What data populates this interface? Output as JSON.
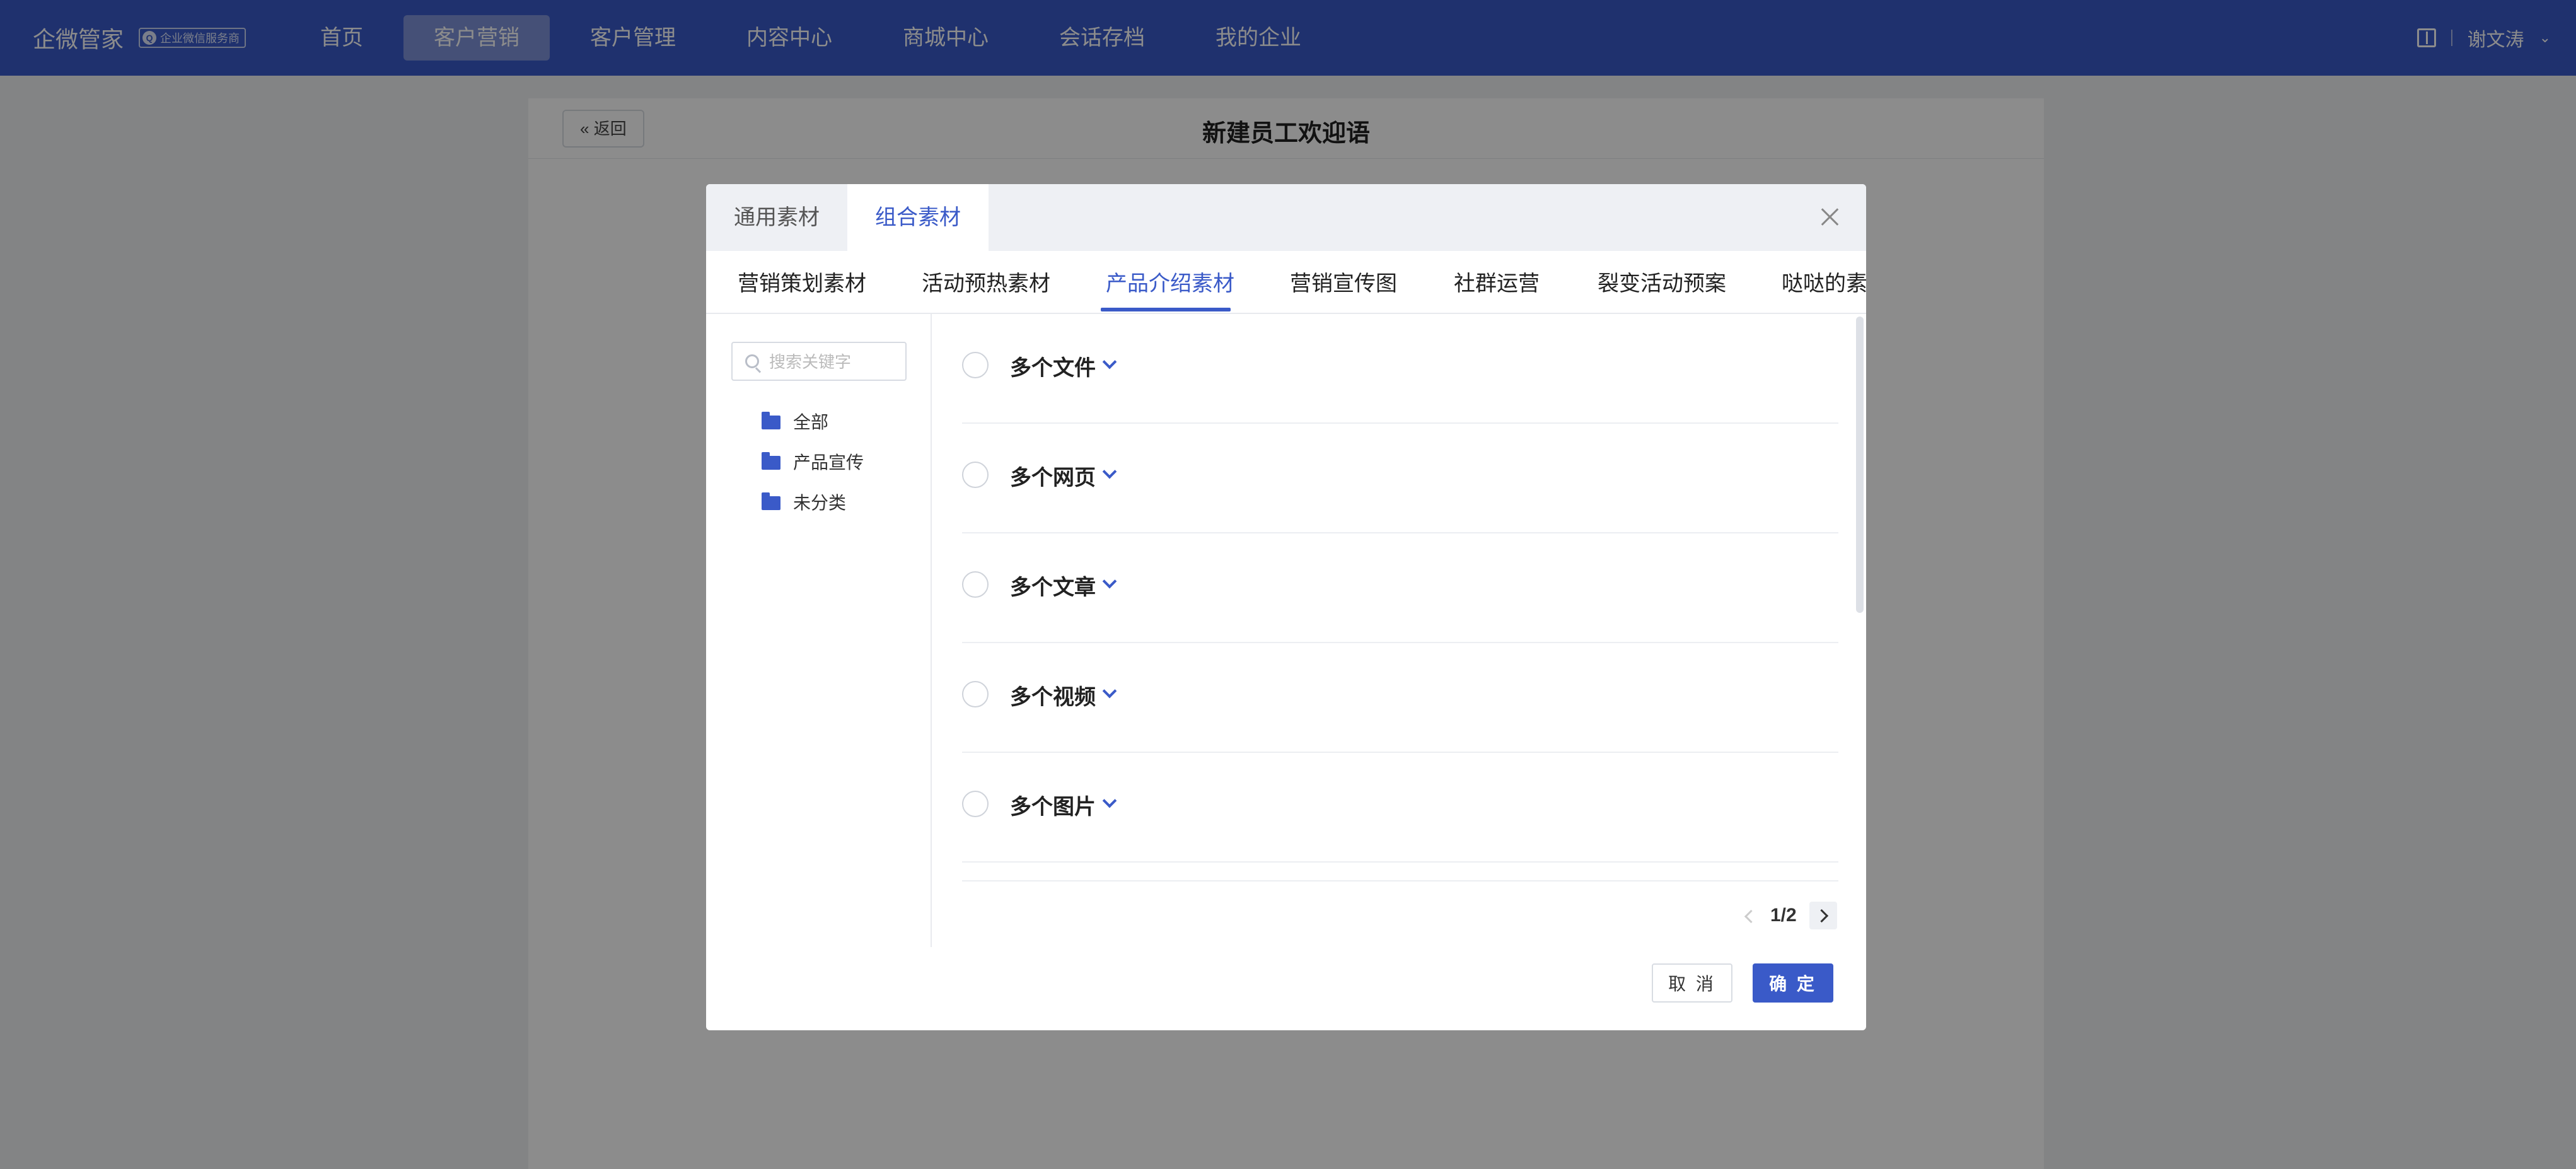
{
  "topbar": {
    "brand": "企微管家",
    "badge": "企业微信服务商",
    "nav": [
      "首页",
      "客户营销",
      "客户管理",
      "内容中心",
      "商城中心",
      "会话存档",
      "我的企业"
    ],
    "active_nav": "客户营销",
    "user": "谢文涛"
  },
  "page": {
    "back_label": "返回",
    "title": "新建员工欢迎语"
  },
  "modal": {
    "tabs": [
      "通用素材",
      "组合素材"
    ],
    "active_tab": "组合素材",
    "categories": [
      "营销策划素材",
      "活动预热素材",
      "产品介绍素材",
      "营销宣传图",
      "社群运营",
      "裂变活动预案",
      "哒哒的素材"
    ],
    "active_category": "产品介绍素材",
    "search_placeholder": "搜索关键字",
    "folders": [
      "全部",
      "产品宣传",
      "未分类"
    ],
    "items": [
      "多个文件",
      "多个网页",
      "多个文章",
      "多个视频",
      "多个图片"
    ],
    "pager": "1/2",
    "cancel_label": "取 消",
    "ok_label": "确 定"
  },
  "colors": {
    "brand": "#3a5ac8",
    "overlay": "rgba(0,0,0,0.45)"
  }
}
